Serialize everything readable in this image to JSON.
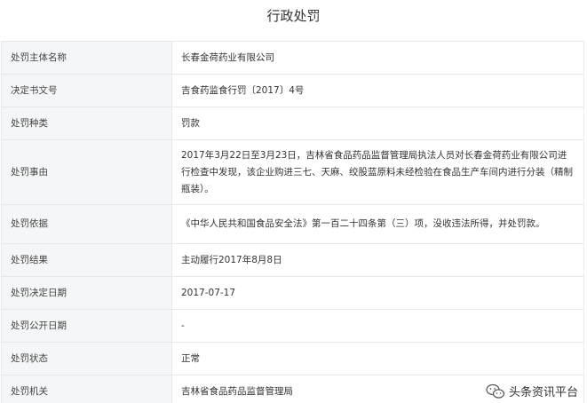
{
  "page": {
    "title": "行政处罚"
  },
  "rows": [
    {
      "label": "处罚主体名称",
      "value": "长春金荷药业有限公司"
    },
    {
      "label": "决定书文号",
      "value": "吉食药监食行罚〔2017〕4号"
    },
    {
      "label": "处罚种类",
      "value": "罚款"
    },
    {
      "label": "处罚事由",
      "value": "2017年3月22日至3月23日，吉林省食品药品监督管理局执法人员对长春金荷药业有限公司进行检查中发现，该企业购进三七、天麻、绞股蓝原料未经检验在食品生产车间内进行分装（精制瓶装）。"
    },
    {
      "label": "处罚依据",
      "value": "《中华人民共和国食品安全法》第一百二十四条第（三）项，没收违法所得，并处罚款。"
    },
    {
      "label": "处罚结果",
      "value": "主动履行2017年8月8日"
    },
    {
      "label": "处罚决定日期",
      "value": "2017-07-17"
    },
    {
      "label": "处罚公开日期",
      "value": "-"
    },
    {
      "label": "处罚状态",
      "value": "正常"
    },
    {
      "label": "处罚机关",
      "value": "吉林省食品药品监督管理局"
    }
  ],
  "watermark": {
    "text": "头条资讯平台",
    "icon": "wechat-logo-icon"
  }
}
